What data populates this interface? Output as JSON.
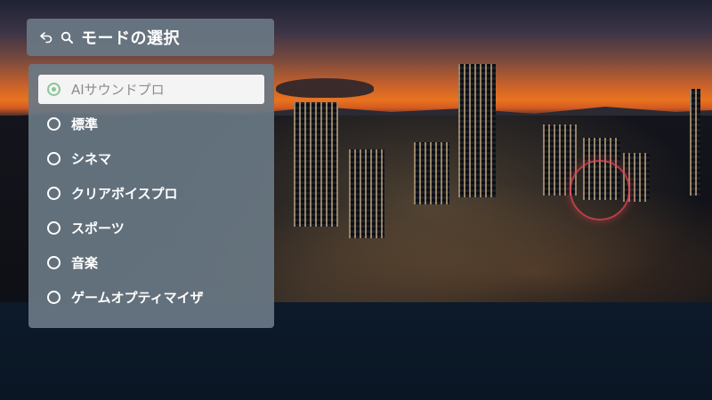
{
  "header": {
    "title": "モードの選択",
    "back_icon": "back-arrow-icon",
    "search_icon": "search-icon"
  },
  "options": [
    {
      "label": "AIサウンドプロ",
      "selected": true
    },
    {
      "label": "標準",
      "selected": false
    },
    {
      "label": "シネマ",
      "selected": false
    },
    {
      "label": "クリアボイスプロ",
      "selected": false
    },
    {
      "label": "スポーツ",
      "selected": false
    },
    {
      "label": "音楽",
      "selected": false
    },
    {
      "label": "ゲームオプティマイザ",
      "selected": false
    }
  ],
  "colors": {
    "panel": "#69788499",
    "selected_bg": "#f4f4f4",
    "radio_selected": "#8bc49a"
  }
}
